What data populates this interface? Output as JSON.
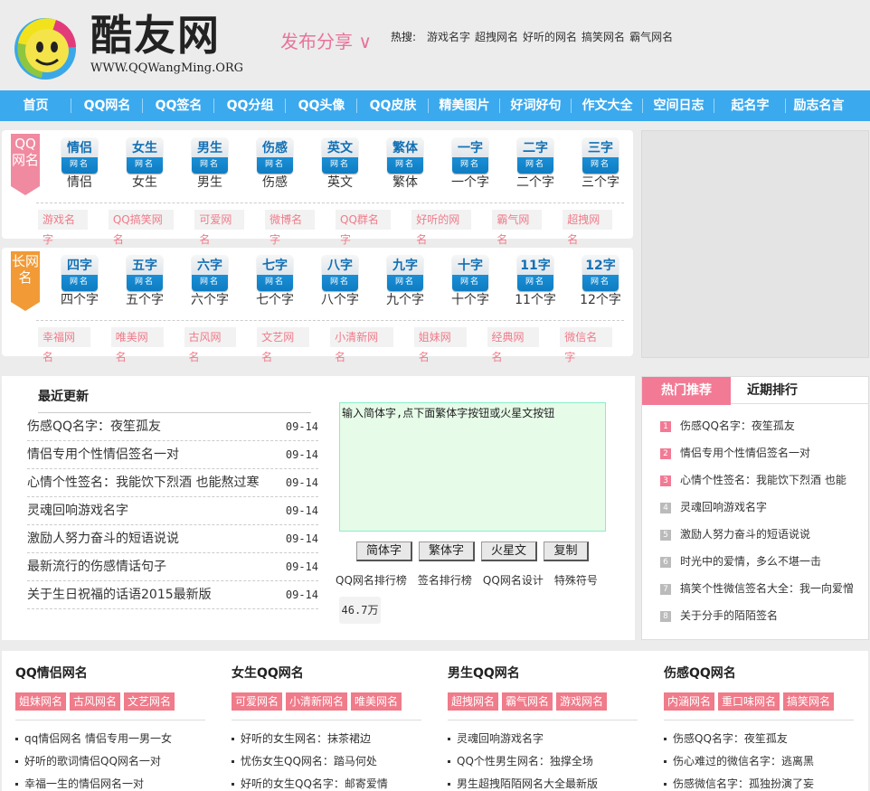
{
  "header": {
    "logo_text": "酷友网",
    "logo_url": "WWW.QQWangMing.ORG",
    "publish_label": "发布分享 ∨",
    "hot_label": "热搜:",
    "hot_links": [
      "游戏名字",
      "超拽网名",
      "好听的网名",
      "搞笑网名",
      "霸气网名"
    ]
  },
  "nav": [
    "首页",
    "QQ网名",
    "QQ签名",
    "QQ分组",
    "QQ头像",
    "QQ皮肤",
    "精美图片",
    "好词好句",
    "作文大全",
    "空间日志",
    "起名字",
    "励志名言"
  ],
  "qq_panel": {
    "ribbon": "QQ网名",
    "sub_badge": "网名",
    "categories": [
      {
        "badge": "情侣",
        "label": "情侣"
      },
      {
        "badge": "女生",
        "label": "女生"
      },
      {
        "badge": "男生",
        "label": "男生"
      },
      {
        "badge": "伤感",
        "label": "伤感"
      },
      {
        "badge": "英文",
        "label": "英文"
      },
      {
        "badge": "繁体",
        "label": "繁体"
      },
      {
        "badge": "一字",
        "label": "一个字"
      },
      {
        "badge": "二字",
        "label": "二个字"
      },
      {
        "badge": "三字",
        "label": "三个字"
      }
    ],
    "tags": [
      "游戏名字",
      "QQ搞笑网名",
      "可爱网名",
      "微博名字",
      "QQ群名字",
      "好听的网名",
      "霸气网名",
      "超拽网名"
    ]
  },
  "long_panel": {
    "ribbon": "长网名",
    "sub_badge": "网名",
    "categories": [
      {
        "badge": "四字",
        "label": "四个字"
      },
      {
        "badge": "五字",
        "label": "五个字"
      },
      {
        "badge": "六字",
        "label": "六个字"
      },
      {
        "badge": "七字",
        "label": "七个字"
      },
      {
        "badge": "八字",
        "label": "八个字"
      },
      {
        "badge": "九字",
        "label": "九个字"
      },
      {
        "badge": "十字",
        "label": "十个字"
      },
      {
        "badge": "11字",
        "label": "11个字"
      },
      {
        "badge": "12字",
        "label": "12个字"
      }
    ],
    "tags": [
      "幸福网名",
      "唯美网名",
      "古风网名",
      "文艺网名",
      "小清新网名",
      "姐妹网名",
      "经典网名",
      "微信名字"
    ]
  },
  "latest": {
    "title": "最近更新",
    "items": [
      {
        "title": "伤感QQ名字：夜笙孤友",
        "date": "09-14"
      },
      {
        "title": "情侣专用个性情侣签名一对",
        "date": "09-14"
      },
      {
        "title": "心情个性签名：我能饮下烈酒 也能熬过寒",
        "date": "09-14"
      },
      {
        "title": "灵魂回响游戏名字",
        "date": "09-14"
      },
      {
        "title": "激励人努力奋斗的短语说说",
        "date": "09-14"
      },
      {
        "title": "最新流行的伤感情话句子",
        "date": "09-14"
      },
      {
        "title": "关于生日祝福的话语2015最新版",
        "date": "09-14"
      }
    ]
  },
  "converter": {
    "placeholder": "输入简体字,点下面繁体字按钮或火星文按钮",
    "buttons": [
      "简体字",
      "繁体字",
      "火星文",
      "复制"
    ],
    "links": [
      "QQ网名排行榜",
      "签名排行榜",
      "QQ网名设计",
      "特殊符号"
    ],
    "count": "46.7万"
  },
  "hot": {
    "tabs": [
      "热门推荐",
      "近期排行"
    ],
    "items": [
      "伤感QQ名字：夜笙孤友",
      "情侣专用个性情侣签名一对",
      "心情个性签名：我能饮下烈酒 也能",
      "灵魂回响游戏名字",
      "激励人努力奋斗的短语说说",
      "时光中的爱情，多么不堪一击",
      "搞笑个性微信签名大全：我一向爱憎",
      "关于分手的陌陌签名"
    ],
    "numbers": [
      "1",
      "2",
      "3",
      "4",
      "5",
      "6",
      "7",
      "8"
    ]
  },
  "bottom": [
    {
      "title": "QQ情侣网名",
      "tags": [
        "姐妹网名",
        "古风网名",
        "文艺网名"
      ],
      "items": [
        "qq情侣网名 情侣专用一男一女",
        "好听的歌词情侣QQ网名一对",
        "幸福一生的情侣网名一对"
      ]
    },
    {
      "title": "女生QQ网名",
      "tags": [
        "可爱网名",
        "小清新网名",
        "唯美网名"
      ],
      "items": [
        "好听的女生网名：抹茶裙边",
        "忧伤女生QQ网名：踏马何处",
        "好听的女生QQ名字：邮寄爱情"
      ]
    },
    {
      "title": "男生QQ网名",
      "tags": [
        "超拽网名",
        "霸气网名",
        "游戏网名"
      ],
      "items": [
        "灵魂回响游戏名字",
        "QQ个性男生网名：独撑全场",
        "男生超拽陌陌网名大全最新版"
      ]
    },
    {
      "title": "伤感QQ网名",
      "tags": [
        "内涵网名",
        "重口味网名",
        "搞笑网名"
      ],
      "items": [
        "伤感QQ名字：夜笙孤友",
        "伤心难过的微信名字：逃离黑",
        "伤感微信名字：孤独扮演了妄"
      ]
    }
  ],
  "colors": {
    "nav_blue": "#3ba9ee",
    "pink": "#f08aa0",
    "orange": "#f19a36",
    "tag_pink": "#f07b8a"
  }
}
